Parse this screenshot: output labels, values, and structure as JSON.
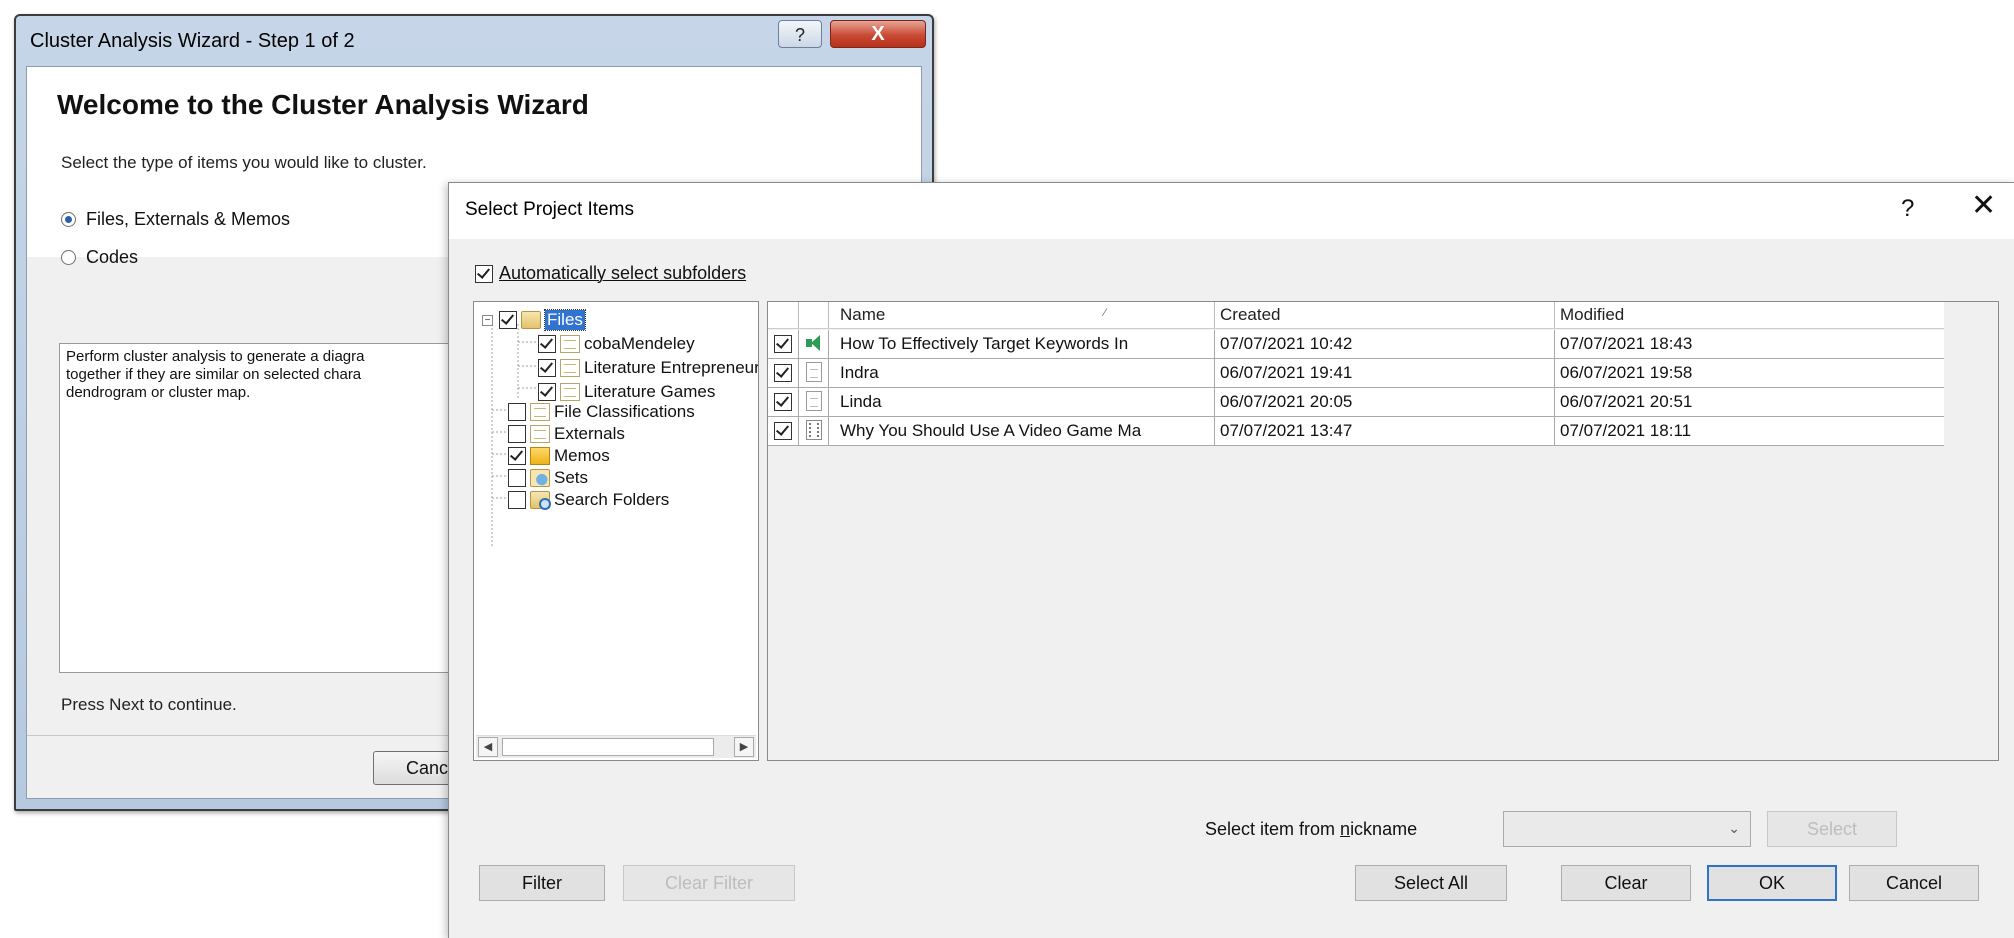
{
  "wizard": {
    "title": "Cluster Analysis Wizard - Step 1 of 2",
    "help_glyph": "?",
    "close_glyph": "X",
    "heading": "Welcome to the Cluster Analysis Wizard",
    "subtitle": "Select the type of items you would like to cluster.",
    "options": [
      {
        "label": "Files, Externals & Memos",
        "selected": true
      },
      {
        "label": "Codes",
        "selected": false
      }
    ],
    "description": "Perform cluster analysis to generate a diagra\ntogether if they are similar on selected chara\ndendrogram or cluster map.",
    "footer_text": "Press Next to continue.",
    "cancel_label": "Cancel"
  },
  "dialog": {
    "title": "Select Project Items",
    "help_glyph": "?",
    "close_glyph": "✕",
    "auto_select": {
      "label": "Automatically select subfolders",
      "checked": true
    },
    "tree": [
      {
        "label": "Files",
        "checked": true,
        "icon": "folder-icon",
        "selected": true
      },
      {
        "label": "cobaMendeley",
        "checked": true,
        "icon": "document-icon"
      },
      {
        "label": "Literature Entrepreneursh",
        "checked": true,
        "icon": "document-icon"
      },
      {
        "label": "Literature Games",
        "checked": true,
        "icon": "document-icon"
      },
      {
        "label": "File Classifications",
        "checked": false,
        "icon": "classification-icon"
      },
      {
        "label": "Externals",
        "checked": false,
        "icon": "externals-icon"
      },
      {
        "label": "Memos",
        "checked": true,
        "icon": "memo-icon"
      },
      {
        "label": "Sets",
        "checked": false,
        "icon": "sets-icon"
      },
      {
        "label": "Search Folders",
        "checked": false,
        "icon": "search-folder-icon"
      }
    ],
    "grid": {
      "columns": [
        "Name",
        "Created",
        "Modified"
      ],
      "rows": [
        {
          "checked": true,
          "icon": "audio-icon",
          "name": "How To Effectively Target Keywords In",
          "created": "07/07/2021 10:42",
          "modified": "07/07/2021 18:43"
        },
        {
          "checked": true,
          "icon": "document-icon",
          "name": "Indra",
          "created": "06/07/2021 19:41",
          "modified": "06/07/2021 19:58"
        },
        {
          "checked": true,
          "icon": "document-icon",
          "name": "Linda",
          "created": "06/07/2021 20:05",
          "modified": "06/07/2021 20:51"
        },
        {
          "checked": true,
          "icon": "video-icon",
          "name": "Why You Should Use A Video Game Ma",
          "created": "07/07/2021 13:47",
          "modified": "07/07/2021 18:11"
        }
      ]
    },
    "nickname_label_pre": "Select item from ",
    "nickname_label_key": "n",
    "nickname_label_post": "ickname",
    "nickname_value": "",
    "buttons": {
      "select": "Select",
      "filter": "Filter",
      "clear_filter": "Clear Filter",
      "select_all": "Select All",
      "clear": "Clear",
      "ok": "OK",
      "cancel": "Cancel"
    }
  }
}
